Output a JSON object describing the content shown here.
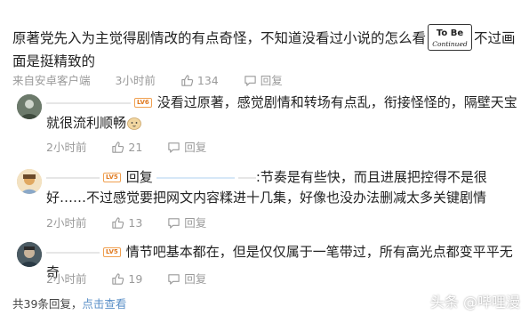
{
  "main_comment": {
    "text_part1": "原著党先入为主觉得剧情改的有点奇怪，不知道没看过小说的怎么看",
    "sticker_text": "To Be Continued",
    "text_part2": "不过画面是挺精致的",
    "source": "来自安卓客户端",
    "time": "3小时前",
    "likes": "134",
    "reply_label": "回复"
  },
  "replies": [
    {
      "badge": "LV6",
      "text": "没看过原著，感觉剧情和转场有点乱，衔接怪怪的，隔壁天宝就很流利顺畅",
      "time": "2小时前",
      "likes": "21",
      "reply_label": "回复"
    },
    {
      "badge": "LV5",
      "reply_prefix": "回复",
      "text": ":节奏是有些快，而且进展把控得不是很好……不过感觉要把网文内容糅进十几集，好像也没办法删减太多关键剧情",
      "time": "2小时前",
      "likes": "13",
      "reply_label": "回复"
    },
    {
      "badge": "LV5",
      "text": "情节吧基本都在，但是仅仅属于一笔带过，所有高光点都变平平无奇",
      "time": "2小时前",
      "likes": "19",
      "reply_label": "回复"
    }
  ],
  "footer": {
    "total_replies": "共39条回复，",
    "collapse": "点击查看"
  },
  "watermark": "头条 @哔哩漫",
  "colors": {
    "link": "#5a8fc7",
    "meta": "#9a9a9a",
    "badge": "#e07a20"
  },
  "icons": [
    "thumb-up-icon",
    "comment-icon"
  ]
}
